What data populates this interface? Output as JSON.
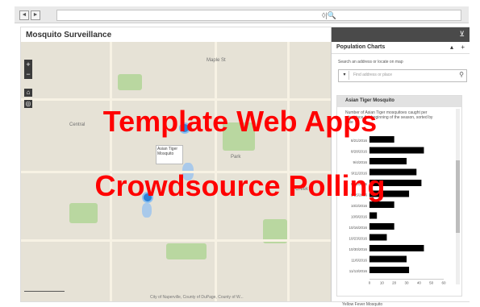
{
  "browser": {
    "back": "◄",
    "forward": "►",
    "search_glyph": "◊|🔍"
  },
  "app": {
    "title": "Mosquito Surveillance"
  },
  "map": {
    "labels": [
      "Maple St",
      "Central",
      "Park",
      "Creek"
    ],
    "popup_text": "Asian Tiger Mosquito",
    "zoom_in": "+",
    "zoom_out": "−",
    "home_glyph": "⌂",
    "locate_glyph": "◎",
    "attribution": "City of Naperville, County of DuPage, County of W..."
  },
  "panel": {
    "title": "Population Charts",
    "search_hint": "Search an address or locate on map",
    "search_placeholder": "Find address or place",
    "chart_title": "Asian Tiger Mosquito",
    "chart_description": "Number of Asian Tiger mosquitoes caught per site, since the beginning of the season, sorted by date",
    "next_section": "Yellow Fever Mosquito"
  },
  "overlay": {
    "line1": "Template Web Apps",
    "line2": "Crowdsource Polling"
  },
  "chart_data": {
    "type": "bar",
    "orientation": "horizontal",
    "categories": [
      "8/21/2016",
      "8/28/2016",
      "9/4/2016",
      "9/11/2016",
      "9/18/2016",
      "9/25/2016",
      "10/2/2016",
      "10/9/2016",
      "10/16/2016",
      "10/23/2016",
      "10/30/2016",
      "11/6/2016",
      "11/13/2016"
    ],
    "values": [
      20,
      44,
      30,
      38,
      42,
      32,
      20,
      6,
      20,
      14,
      44,
      30,
      32
    ],
    "xlim": [
      0,
      60
    ],
    "xticks": [
      0,
      10,
      20,
      30,
      40,
      50,
      60
    ],
    "grid": false
  }
}
